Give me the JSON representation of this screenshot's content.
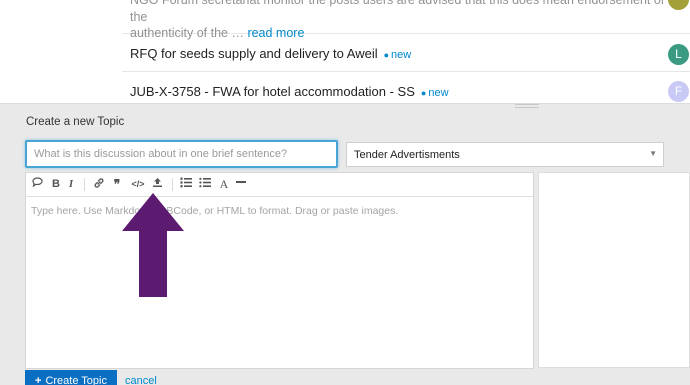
{
  "topics": {
    "excerpt": {
      "line1": "NGO Forum secretariat monitor the posts users are advised that this does mean endorsement of the",
      "line2": "authenticity of the … ",
      "read_more": "read more"
    },
    "rows": [
      {
        "title": "RFQ for seeds supply and delivery to Aweil",
        "badge": "new",
        "avatar": "L",
        "avatar_color": "#3a9b82"
      },
      {
        "title": "JUB-X-3758 - FWA for hotel accommodation - SS",
        "badge": "new",
        "avatar": "F",
        "avatar_color": "#c9c9f5"
      }
    ],
    "top_avatar_color": "#a3a03a"
  },
  "composer": {
    "heading": "Create a new Topic",
    "title_placeholder": "What is this discussion about in one brief sentence?",
    "category": "Tender Advertisments",
    "editor_placeholder": "Type here. Use Markdown, BBCode, or HTML to format. Drag or paste images.",
    "toolbar": {
      "bold": "B",
      "italic": "I",
      "quote": "❞",
      "code": "</>",
      "heading": "A"
    },
    "create_button": "Create Topic",
    "create_icon": "+",
    "cancel": "cancel"
  },
  "colors": {
    "accent": "#0088cc",
    "button": "#0a6fc2",
    "arrow": "#5c1a70"
  }
}
